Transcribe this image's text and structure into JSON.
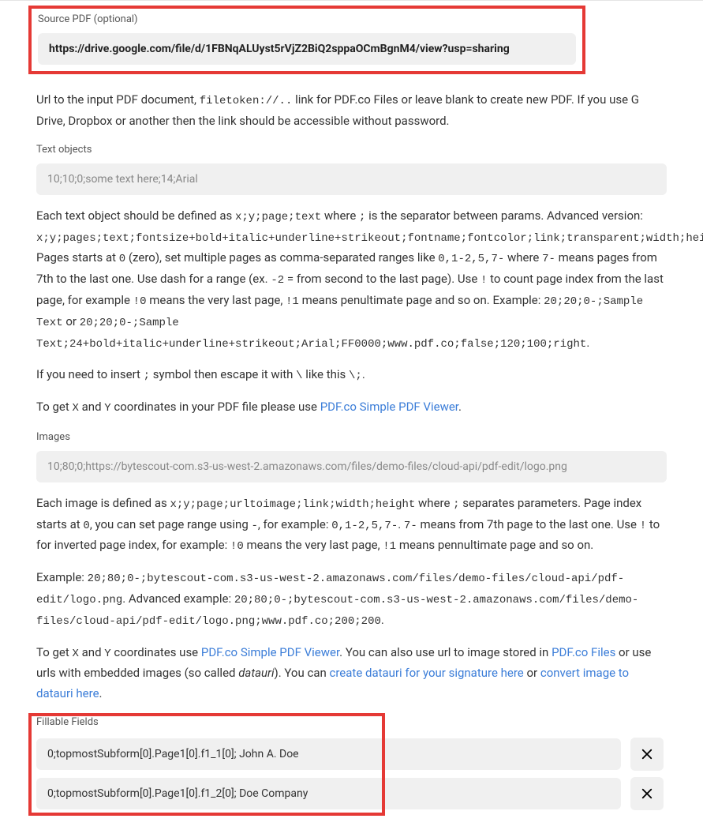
{
  "sourcePdf": {
    "label": "Source PDF (optional)",
    "value": "https://drive.google.com/file/d/1FBNqALUyst5rVjZ2BiQ2sppaOCmBgnM4/view?usp=sharing",
    "help_1": "Url to the input PDF document, ",
    "help_code": "filetoken://..",
    "help_2": " link for PDF.co Files or leave blank to create new PDF. If you use G Drive, Dropbox or another then the link should be accessible without password."
  },
  "textObjects": {
    "label": "Text objects",
    "placeholder": "10;10;0;some text here;14;Arial",
    "help": {
      "t1": "Each text object should be defined as ",
      "c1": "x;y;page;text",
      "t2": " where ",
      "c2": ";",
      "t3": " is the separator between params. Advanced version: ",
      "c3": "x;y;pages;text;fontsize+bold+italic+underline+strikeout;fontname;fontcolor;link;transparent;width;height;alignment",
      "t4": ". Pages starts at ",
      "c4": "0",
      "t5": " (zero), set multiple pages as comma-separated ranges like ",
      "c5": "0,1-2,5,7-",
      "t6": " where ",
      "c6": "7-",
      "t7": " means pages from 7th to the last one. Use dash for a range (ex. ",
      "c7": "-2",
      "t8": " = from second to the last page). Use ",
      "c8": "!",
      "t9": " to count page index from the last page, for example ",
      "c9": "!0",
      "t10": " means the very last page, ",
      "c10": "!1",
      "t11": " means penultimate page and so on. Example: ",
      "c11": "20;20;0-;Sample Text",
      "t12": " or ",
      "c12": "20;20;0-;Sample Text;24+bold+italic+underline+strikeout;Arial;FF0000;www.pdf.co;false;120;100;right",
      "t13": "."
    },
    "escape": {
      "t1": "If you need to insert ",
      "c1": ";",
      "t2": " symbol then escape it with ",
      "c2": "\\",
      "t3": " like this ",
      "c3": "\\;",
      "t4": "."
    },
    "coords": {
      "t1": "To get ",
      "c1": "X",
      "t2": " and ",
      "c2": "Y",
      "t3": " coordinates in your PDF file please use ",
      "link": "PDF.co Simple PDF Viewer",
      "t4": "."
    }
  },
  "images": {
    "label": "Images",
    "placeholder": "10;80;0;https://bytescout-com.s3-us-west-2.amazonaws.com/files/demo-files/cloud-api/pdf-edit/logo.png",
    "help1": {
      "t1": "Each image is defined as ",
      "c1": "x;y;page;urltoimage;link;width;height",
      "t2": " where ",
      "c2": ";",
      "t3": " separates parameters. Page index starts at ",
      "c3": "0",
      "t4": ", you can set page range using ",
      "c4": "-",
      "t5": ", for example: ",
      "c5": "0,1-2,5,7-",
      "t6": ". ",
      "c6": "7-",
      "t7": " means from 7th page to the last one. Use ",
      "c7": "!",
      "t8": " to for inverted page index, for example: ",
      "c8": "!0",
      "t9": " means the very last page, ",
      "c9": "!1",
      "t10": " means pennultimate page and so on."
    },
    "help2": {
      "t1": "Example: ",
      "c1": "20;80;0-;bytescout-com.s3-us-west-2.amazonaws.com/files/demo-files/cloud-api/pdf-edit/logo.png",
      "t2": ". Advanced example: ",
      "c2": "20;80;0-;bytescout-com.s3-us-west-2.amazonaws.com/files/demo-files/cloud-api/pdf-edit/logo.png;www.pdf.co;200;200",
      "t3": "."
    },
    "help3": {
      "t1": "To get ",
      "c1": "X",
      "t2": " and ",
      "c2": "Y",
      "t3": " coordinates use ",
      "link1": "PDF.co Simple PDF Viewer",
      "t4": ". You can also use url to image stored in ",
      "link2": "PDF.co Files",
      "t5": " or use urls with embedded images (so called ",
      "i1": "datauri",
      "t6": "). You can ",
      "link3": "create datauri for your signature here",
      "t7": " or ",
      "link4": "convert image to datauri here",
      "t8": "."
    }
  },
  "fillable": {
    "label": "Fillable Fields",
    "rows": [
      "0;topmostSubform[0].Page1[0].f1_1[0]; John A. Doe",
      "0;topmostSubform[0].Page1[0].f1_2[0]; Doe Company"
    ]
  }
}
